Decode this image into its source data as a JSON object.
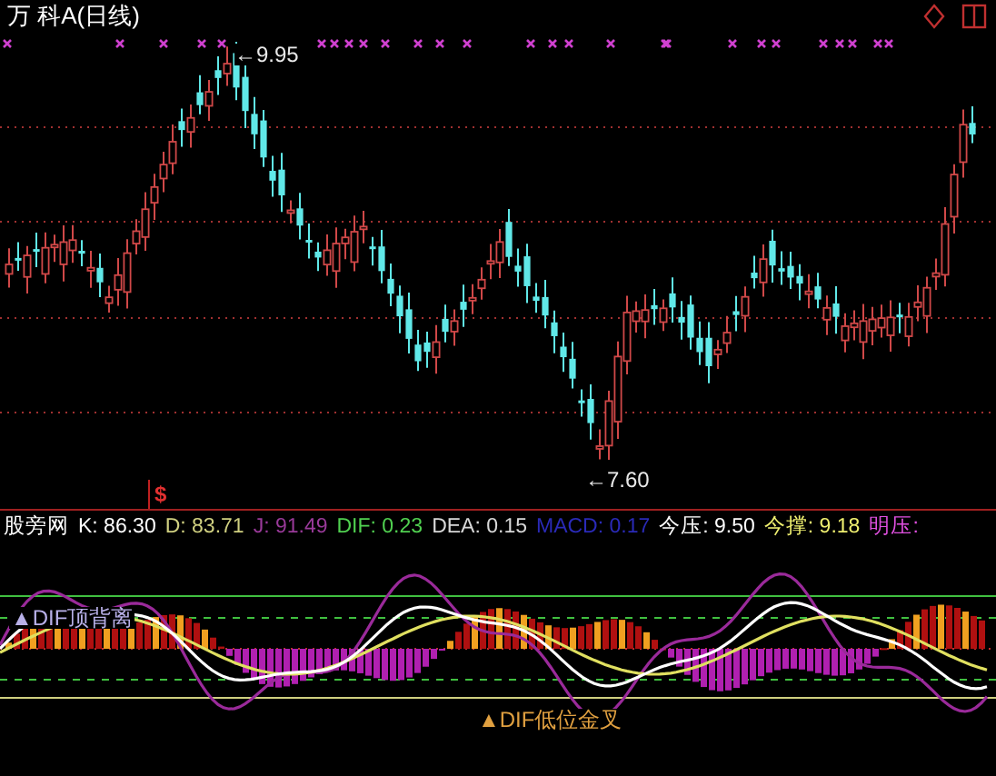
{
  "title": "万 科A(日线)",
  "price_labels": [
    {
      "kind": "high",
      "text": "←9.95"
    },
    {
      "kind": "low",
      "text": "←7.60"
    }
  ],
  "signal_mark": "$",
  "indicator": {
    "name": "股旁网",
    "values": [
      {
        "label": "K:",
        "value": "86.30",
        "color": "#ffffff"
      },
      {
        "label": "D:",
        "value": "83.71",
        "color": "#d0d080"
      },
      {
        "label": "J:",
        "value": "91.49",
        "color": "#9a3a9a"
      },
      {
        "label": "DIF:",
        "value": "0.23",
        "color": "#50d050"
      },
      {
        "label": "DEA:",
        "value": "0.15",
        "color": "#d8d8d8"
      },
      {
        "label": "MACD:",
        "value": "0.17",
        "color": "#2a2ab8"
      },
      {
        "label": "今压:",
        "value": "9.50",
        "color": "#ffffff"
      },
      {
        "label": "今撑:",
        "value": "9.18",
        "color": "#f0f070"
      },
      {
        "label": "明压:",
        "color": "#e050e0"
      }
    ]
  },
  "annotations": [
    {
      "kind": "top",
      "text": "▲DIF顶背离",
      "color": "#b8b0e8"
    },
    {
      "kind": "bottom",
      "text": "▲DIF低位金叉",
      "color": "#e0a040"
    }
  ]
}
